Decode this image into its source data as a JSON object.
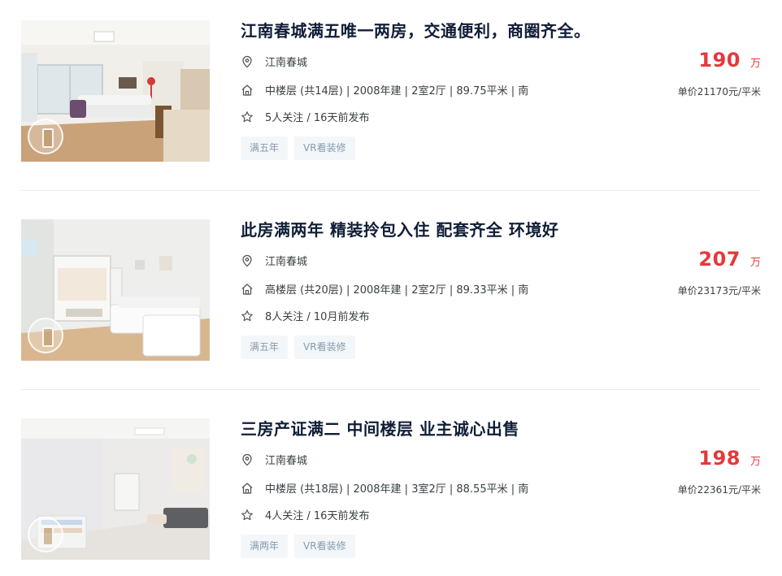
{
  "listings": [
    {
      "title": "江南春城满五唯一两房，交通便利，商圈齐全。",
      "community": "江南春城",
      "info": "中楼层 (共14层) | 2008年建 | 2室2厅 | 89.75平米 | 南",
      "follow": "5人关注 / 16天前发布",
      "tags": [
        "满五年",
        "VR看装修"
      ],
      "total_price": "190",
      "total_unit": "万",
      "unit_price": "单价21170元/平米"
    },
    {
      "title": "此房满两年 精装拎包入住 配套齐全 环境好",
      "community": "江南春城",
      "info": "高楼层 (共20层) | 2008年建 | 2室2厅 | 89.33平米 | 南",
      "follow": "8人关注 / 10月前发布",
      "tags": [
        "满五年",
        "VR看装修"
      ],
      "total_price": "207",
      "total_unit": "万",
      "unit_price": "单价23173元/平米"
    },
    {
      "title": "三房产证满二 中间楼层 业主诚心出售",
      "community": "江南春城",
      "info": "中楼层 (共18层) | 2008年建 | 3室2厅 | 88.55平米 | 南",
      "follow": "4人关注 / 16天前发布",
      "tags": [
        "满两年",
        "VR看装修"
      ],
      "total_price": "198",
      "total_unit": "万",
      "unit_price": "单价22361元/平米"
    }
  ],
  "icons": {
    "location": "location-pin-icon",
    "house": "house-icon",
    "follow": "star-icon",
    "vr": "vr-badge-icon"
  },
  "colors": {
    "price": "#e4393c",
    "title": "#101d37",
    "tag_text": "#849aae",
    "tag_bg": "#f4f7f9"
  }
}
